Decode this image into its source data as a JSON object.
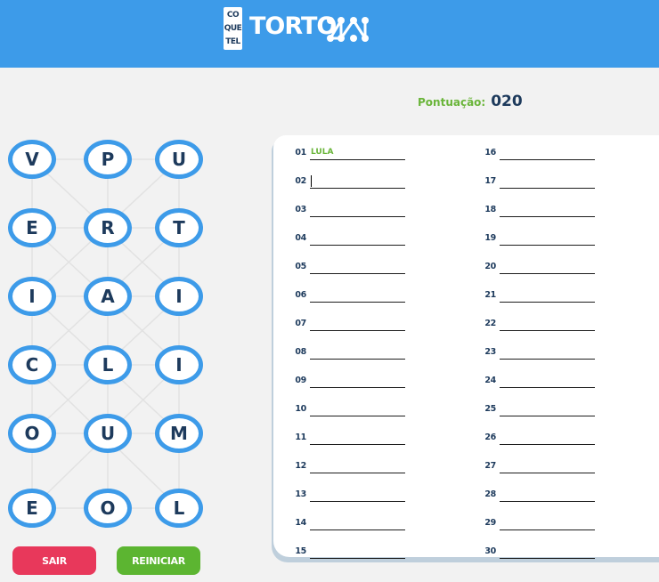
{
  "header": {
    "logo_lines": [
      "CO",
      "QUE",
      "TEL"
    ],
    "title": "TORTO"
  },
  "score": {
    "label": "Pontuação:",
    "value": "020"
  },
  "board": {
    "rows": [
      [
        "V",
        "P",
        "U"
      ],
      [
        "E",
        "R",
        "T"
      ],
      [
        "I",
        "A",
        "I"
      ],
      [
        "C",
        "L",
        "I"
      ],
      [
        "O",
        "U",
        "M"
      ],
      [
        "E",
        "O",
        "L"
      ]
    ]
  },
  "buttons": {
    "exit": "SAIR",
    "restart": "REINICIAR"
  },
  "answers": {
    "slots": [
      {
        "num": "01",
        "word": "LULA"
      },
      {
        "num": "02",
        "word": ""
      },
      {
        "num": "03",
        "word": ""
      },
      {
        "num": "04",
        "word": ""
      },
      {
        "num": "05",
        "word": ""
      },
      {
        "num": "06",
        "word": ""
      },
      {
        "num": "07",
        "word": ""
      },
      {
        "num": "08",
        "word": ""
      },
      {
        "num": "09",
        "word": ""
      },
      {
        "num": "10",
        "word": ""
      },
      {
        "num": "11",
        "word": ""
      },
      {
        "num": "12",
        "word": ""
      },
      {
        "num": "13",
        "word": ""
      },
      {
        "num": "14",
        "word": ""
      },
      {
        "num": "15",
        "word": ""
      },
      {
        "num": "16",
        "word": ""
      },
      {
        "num": "17",
        "word": ""
      },
      {
        "num": "18",
        "word": ""
      },
      {
        "num": "19",
        "word": ""
      },
      {
        "num": "20",
        "word": ""
      },
      {
        "num": "21",
        "word": ""
      },
      {
        "num": "22",
        "word": ""
      },
      {
        "num": "23",
        "word": ""
      },
      {
        "num": "24",
        "word": ""
      },
      {
        "num": "25",
        "word": ""
      },
      {
        "num": "26",
        "word": ""
      },
      {
        "num": "27",
        "word": ""
      },
      {
        "num": "28",
        "word": ""
      },
      {
        "num": "29",
        "word": ""
      },
      {
        "num": "30",
        "word": ""
      }
    ]
  },
  "colors": {
    "header": "#3d9be9",
    "tile_border": "#3d9be9",
    "text_dark": "#1d3a5c",
    "accent_green": "#6ab53a",
    "exit_button": "#e8385b",
    "restart_button": "#5cb531"
  }
}
